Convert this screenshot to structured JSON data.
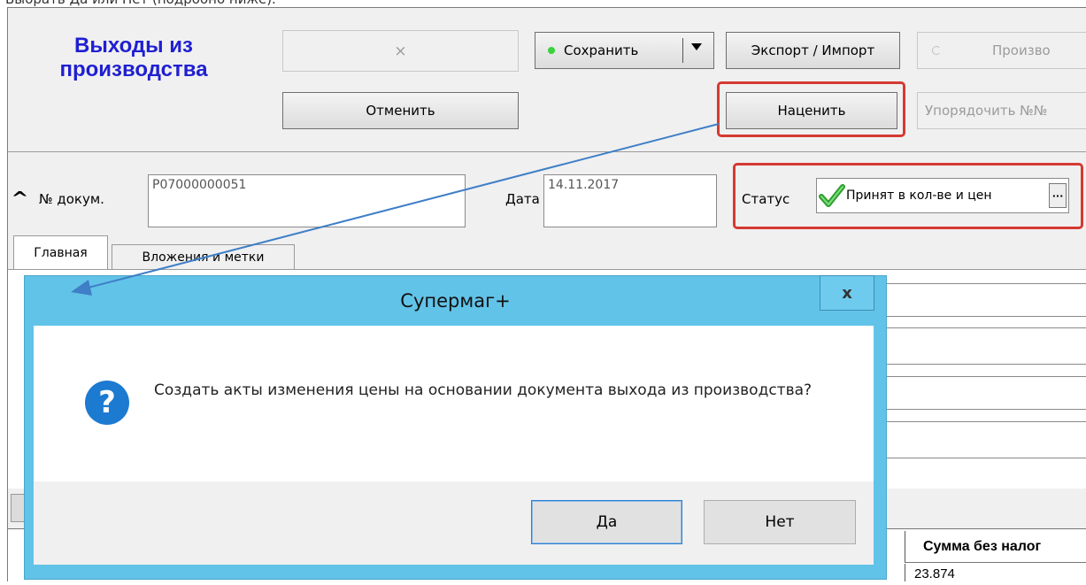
{
  "top_caption": "Выбрать Да или Нет (подробно ниже).",
  "header": {
    "title": "Выходы из производства",
    "close_mark": "×",
    "save_label": "Сохранить",
    "export_label": "Экспорт / Импорт",
    "prod_radio_label": "Произво",
    "cancel_label": "Отменить",
    "markup_label": "Наценить",
    "order_label": "Упорядочить №№"
  },
  "doc": {
    "collapse_glyph": "^",
    "number_label": "№ докум.",
    "number_value": "Р07000000051",
    "date_label": "Дата",
    "date_value": "14.11.2017",
    "status_label": "Статус",
    "status_value": "Принят в кол-ве и цен",
    "status_more": "···"
  },
  "tabs": [
    {
      "label": "Главная"
    },
    {
      "label": "Вложения и метки"
    }
  ],
  "grid": {
    "column_header": "Сумма без налог",
    "first_value": "23.874"
  },
  "dialog": {
    "title": "Супермаг+",
    "close": "x",
    "icon": "question-icon",
    "message": "Создать акты изменения цены на основании документа выхода из производства?",
    "yes_label": "Да",
    "no_label": "Нет"
  },
  "colors": {
    "highlight": "#d43a32",
    "arrow": "#3f7fc7",
    "title_blue": "#1f1fd2",
    "dialog_frame": "#62c3e8"
  }
}
